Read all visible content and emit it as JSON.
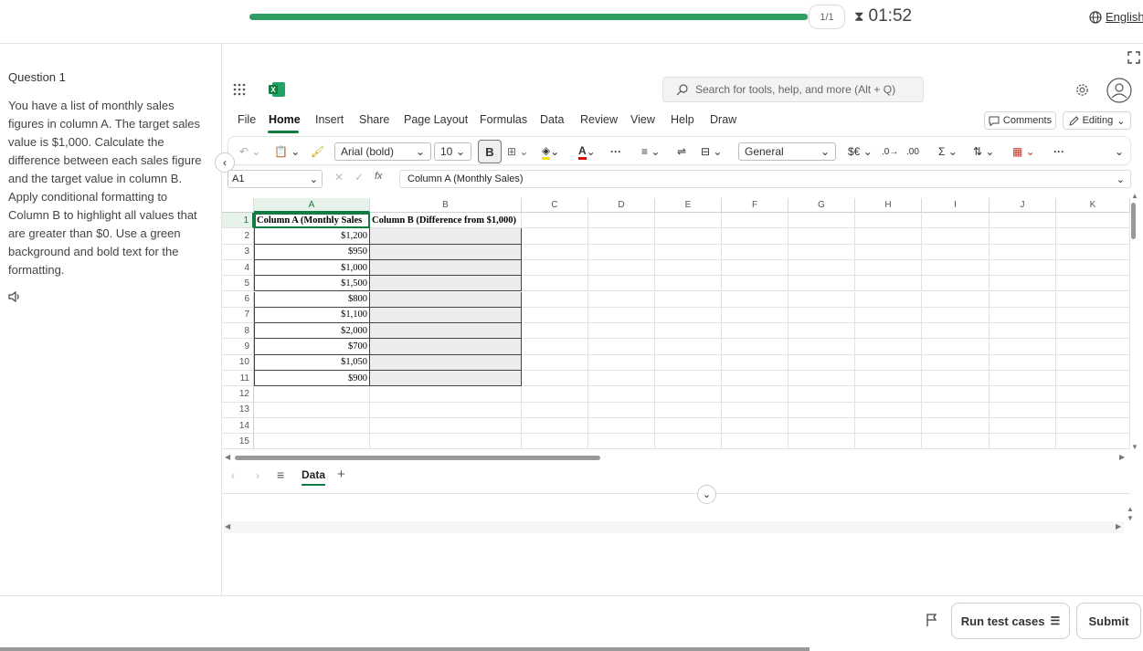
{
  "progress": {
    "page_badge": "1/1",
    "fraction": 0.995,
    "timer": "01:52",
    "language": "English"
  },
  "question": {
    "title": "Question 1",
    "text": "You have a list of monthly sales figures in column A. The target sales value is $1,000. Calculate the difference between each sales figure and the target value in column B. Apply conditional formatting to Column B to highlight all values that are greater than $0. Use a green background and bold text for the formatting."
  },
  "excel": {
    "search_placeholder": "Search for tools, help, and more (Alt + Q)",
    "menu": [
      "File",
      "Home",
      "Insert",
      "Share",
      "Page Layout",
      "Formulas",
      "Data",
      "Review",
      "View",
      "Help",
      "Draw"
    ],
    "comments_label": "Comments",
    "editing_label": "Editing",
    "font_name": "Arial (bold)",
    "font_size": "10",
    "bold_label": "B",
    "number_format": "General",
    "currency_label": "$€",
    "name_box": "A1",
    "fx_label": "fx",
    "formula_value": "Column A (Monthly Sales)",
    "columns": [
      "A",
      "B",
      "C",
      "D",
      "E",
      "F",
      "G",
      "H",
      "I",
      "J",
      "K"
    ],
    "rows": [
      "1",
      "2",
      "3",
      "4",
      "5",
      "6",
      "7",
      "8",
      "9",
      "10",
      "11",
      "12",
      "13",
      "14",
      "15"
    ],
    "header_a": "Column A (Monthly Sales",
    "header_b": "Column B (Difference from $1,000)",
    "sales": [
      "$1,200",
      "$950",
      "$1,000",
      "$1,500",
      "$800",
      "$1,100",
      "$2,000",
      "$700",
      "$1,050",
      "$900"
    ],
    "sheet_tab": "Data"
  },
  "footer": {
    "run_label": "Run test cases",
    "submit_label": "Submit"
  },
  "colors": {
    "accent": "#2e9e63",
    "excel_green": "#107c41",
    "selection": "#e6f2ea"
  }
}
